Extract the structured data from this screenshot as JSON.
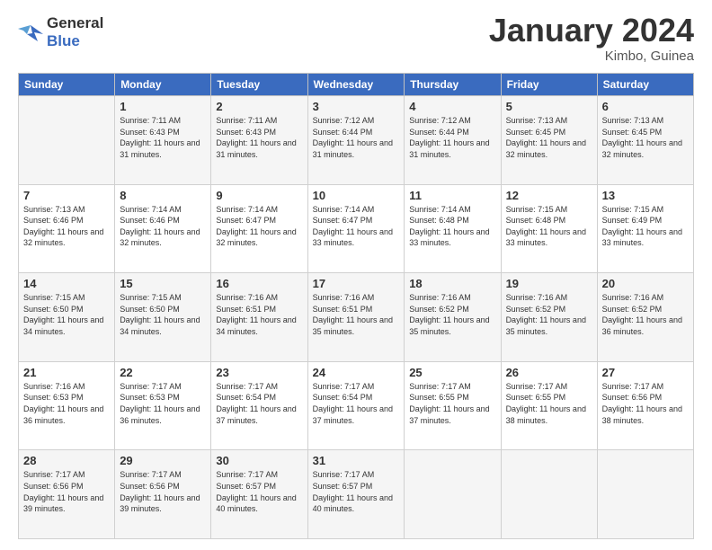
{
  "logo": {
    "line1": "General",
    "line2": "Blue"
  },
  "title": "January 2024",
  "location": "Kimbo, Guinea",
  "days_header": [
    "Sunday",
    "Monday",
    "Tuesday",
    "Wednesday",
    "Thursday",
    "Friday",
    "Saturday"
  ],
  "weeks": [
    [
      {
        "day": "",
        "sunrise": "",
        "sunset": "",
        "daylight": ""
      },
      {
        "day": "1",
        "sunrise": "Sunrise: 7:11 AM",
        "sunset": "Sunset: 6:43 PM",
        "daylight": "Daylight: 11 hours and 31 minutes."
      },
      {
        "day": "2",
        "sunrise": "Sunrise: 7:11 AM",
        "sunset": "Sunset: 6:43 PM",
        "daylight": "Daylight: 11 hours and 31 minutes."
      },
      {
        "day": "3",
        "sunrise": "Sunrise: 7:12 AM",
        "sunset": "Sunset: 6:44 PM",
        "daylight": "Daylight: 11 hours and 31 minutes."
      },
      {
        "day": "4",
        "sunrise": "Sunrise: 7:12 AM",
        "sunset": "Sunset: 6:44 PM",
        "daylight": "Daylight: 11 hours and 31 minutes."
      },
      {
        "day": "5",
        "sunrise": "Sunrise: 7:13 AM",
        "sunset": "Sunset: 6:45 PM",
        "daylight": "Daylight: 11 hours and 32 minutes."
      },
      {
        "day": "6",
        "sunrise": "Sunrise: 7:13 AM",
        "sunset": "Sunset: 6:45 PM",
        "daylight": "Daylight: 11 hours and 32 minutes."
      }
    ],
    [
      {
        "day": "7",
        "sunrise": "Sunrise: 7:13 AM",
        "sunset": "Sunset: 6:46 PM",
        "daylight": "Daylight: 11 hours and 32 minutes."
      },
      {
        "day": "8",
        "sunrise": "Sunrise: 7:14 AM",
        "sunset": "Sunset: 6:46 PM",
        "daylight": "Daylight: 11 hours and 32 minutes."
      },
      {
        "day": "9",
        "sunrise": "Sunrise: 7:14 AM",
        "sunset": "Sunset: 6:47 PM",
        "daylight": "Daylight: 11 hours and 32 minutes."
      },
      {
        "day": "10",
        "sunrise": "Sunrise: 7:14 AM",
        "sunset": "Sunset: 6:47 PM",
        "daylight": "Daylight: 11 hours and 33 minutes."
      },
      {
        "day": "11",
        "sunrise": "Sunrise: 7:14 AM",
        "sunset": "Sunset: 6:48 PM",
        "daylight": "Daylight: 11 hours and 33 minutes."
      },
      {
        "day": "12",
        "sunrise": "Sunrise: 7:15 AM",
        "sunset": "Sunset: 6:48 PM",
        "daylight": "Daylight: 11 hours and 33 minutes."
      },
      {
        "day": "13",
        "sunrise": "Sunrise: 7:15 AM",
        "sunset": "Sunset: 6:49 PM",
        "daylight": "Daylight: 11 hours and 33 minutes."
      }
    ],
    [
      {
        "day": "14",
        "sunrise": "Sunrise: 7:15 AM",
        "sunset": "Sunset: 6:50 PM",
        "daylight": "Daylight: 11 hours and 34 minutes."
      },
      {
        "day": "15",
        "sunrise": "Sunrise: 7:15 AM",
        "sunset": "Sunset: 6:50 PM",
        "daylight": "Daylight: 11 hours and 34 minutes."
      },
      {
        "day": "16",
        "sunrise": "Sunrise: 7:16 AM",
        "sunset": "Sunset: 6:51 PM",
        "daylight": "Daylight: 11 hours and 34 minutes."
      },
      {
        "day": "17",
        "sunrise": "Sunrise: 7:16 AM",
        "sunset": "Sunset: 6:51 PM",
        "daylight": "Daylight: 11 hours and 35 minutes."
      },
      {
        "day": "18",
        "sunrise": "Sunrise: 7:16 AM",
        "sunset": "Sunset: 6:52 PM",
        "daylight": "Daylight: 11 hours and 35 minutes."
      },
      {
        "day": "19",
        "sunrise": "Sunrise: 7:16 AM",
        "sunset": "Sunset: 6:52 PM",
        "daylight": "Daylight: 11 hours and 35 minutes."
      },
      {
        "day": "20",
        "sunrise": "Sunrise: 7:16 AM",
        "sunset": "Sunset: 6:52 PM",
        "daylight": "Daylight: 11 hours and 36 minutes."
      }
    ],
    [
      {
        "day": "21",
        "sunrise": "Sunrise: 7:16 AM",
        "sunset": "Sunset: 6:53 PM",
        "daylight": "Daylight: 11 hours and 36 minutes."
      },
      {
        "day": "22",
        "sunrise": "Sunrise: 7:17 AM",
        "sunset": "Sunset: 6:53 PM",
        "daylight": "Daylight: 11 hours and 36 minutes."
      },
      {
        "day": "23",
        "sunrise": "Sunrise: 7:17 AM",
        "sunset": "Sunset: 6:54 PM",
        "daylight": "Daylight: 11 hours and 37 minutes."
      },
      {
        "day": "24",
        "sunrise": "Sunrise: 7:17 AM",
        "sunset": "Sunset: 6:54 PM",
        "daylight": "Daylight: 11 hours and 37 minutes."
      },
      {
        "day": "25",
        "sunrise": "Sunrise: 7:17 AM",
        "sunset": "Sunset: 6:55 PM",
        "daylight": "Daylight: 11 hours and 37 minutes."
      },
      {
        "day": "26",
        "sunrise": "Sunrise: 7:17 AM",
        "sunset": "Sunset: 6:55 PM",
        "daylight": "Daylight: 11 hours and 38 minutes."
      },
      {
        "day": "27",
        "sunrise": "Sunrise: 7:17 AM",
        "sunset": "Sunset: 6:56 PM",
        "daylight": "Daylight: 11 hours and 38 minutes."
      }
    ],
    [
      {
        "day": "28",
        "sunrise": "Sunrise: 7:17 AM",
        "sunset": "Sunset: 6:56 PM",
        "daylight": "Daylight: 11 hours and 39 minutes."
      },
      {
        "day": "29",
        "sunrise": "Sunrise: 7:17 AM",
        "sunset": "Sunset: 6:56 PM",
        "daylight": "Daylight: 11 hours and 39 minutes."
      },
      {
        "day": "30",
        "sunrise": "Sunrise: 7:17 AM",
        "sunset": "Sunset: 6:57 PM",
        "daylight": "Daylight: 11 hours and 40 minutes."
      },
      {
        "day": "31",
        "sunrise": "Sunrise: 7:17 AM",
        "sunset": "Sunset: 6:57 PM",
        "daylight": "Daylight: 11 hours and 40 minutes."
      },
      {
        "day": "",
        "sunrise": "",
        "sunset": "",
        "daylight": ""
      },
      {
        "day": "",
        "sunrise": "",
        "sunset": "",
        "daylight": ""
      },
      {
        "day": "",
        "sunrise": "",
        "sunset": "",
        "daylight": ""
      }
    ]
  ]
}
